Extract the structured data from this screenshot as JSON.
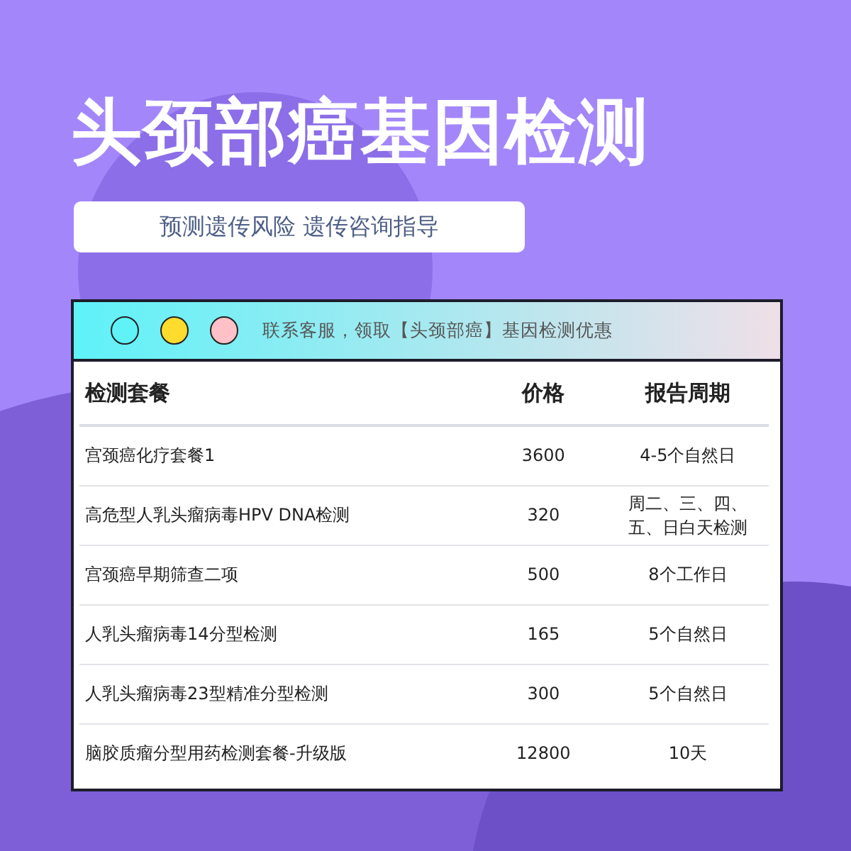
{
  "title": "头颈部癌基因检测",
  "subtitle": "预测遗传风险 遗传咨询指导",
  "window": {
    "dots": [
      {
        "color": "#5ff3f8"
      },
      {
        "color": "#fedc2e"
      },
      {
        "color": "#ffc0c8"
      }
    ],
    "banner": "联系客服，领取【头颈部癌】基因检测优惠"
  },
  "table": {
    "columns": [
      "检测套餐",
      "价格",
      "报告周期"
    ],
    "rows": [
      [
        "宫颈癌化疗套餐1",
        "3600",
        "4-5个自然日"
      ],
      [
        "高危型人乳头瘤病毒HPV DNA检测",
        "320",
        "周二、三、四、五、日白天检测"
      ],
      [
        "宫颈癌早期筛查二项",
        "500",
        "8个工作日"
      ],
      [
        "人乳头瘤病毒14分型检测",
        "165",
        "5个自然日"
      ],
      [
        "人乳头瘤病毒23型精准分型检测",
        "300",
        "5个自然日"
      ],
      [
        "脑胶质瘤分型用药检测套餐-升级版",
        "12800",
        "10天"
      ]
    ]
  }
}
